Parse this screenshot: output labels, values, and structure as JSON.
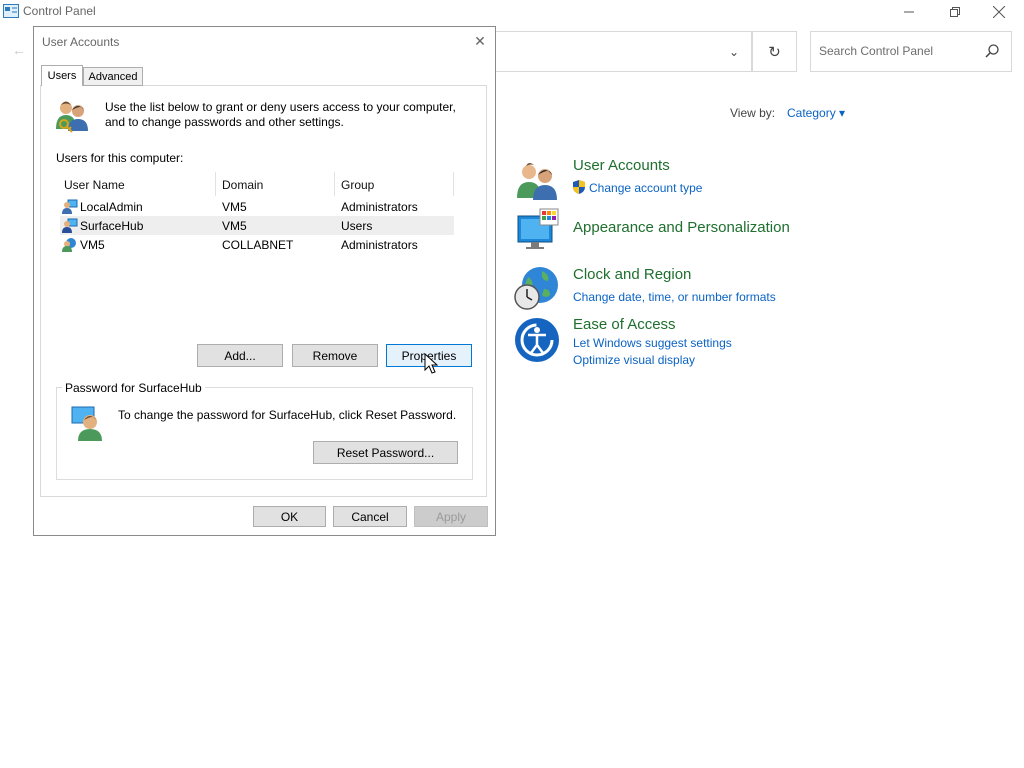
{
  "window": {
    "title": "Control Panel",
    "back_glyph": "←",
    "address_dropdown_glyph": "⌄",
    "refresh_glyph": "↻",
    "search_placeholder": "Search Control Panel"
  },
  "view_by": {
    "label": "View by:",
    "value": "Category ▾"
  },
  "categories": [
    {
      "title": "User Accounts",
      "links": [
        "Change account type"
      ],
      "icon": "users-icon"
    },
    {
      "title": "Appearance and Personalization",
      "links": [],
      "icon": "appearance-icon"
    },
    {
      "title": "Clock and Region",
      "links": [
        "Change date, time, or number formats"
      ],
      "icon": "clock-globe-icon"
    },
    {
      "title": "Ease of Access",
      "links": [
        "Let Windows suggest settings",
        "Optimize visual display"
      ],
      "icon": "ease-of-access-icon"
    }
  ],
  "dialog": {
    "title": "User Accounts",
    "close_glyph": "✕",
    "tabs": [
      "Users",
      "Advanced"
    ],
    "info_text": "Use the list below to grant or deny users access to your computer, and to change passwords and other settings.",
    "users_label": "Users for this computer:",
    "columns": [
      "User Name",
      "Domain",
      "Group"
    ],
    "users": [
      {
        "name": "LocalAdmin",
        "domain": "VM5",
        "group": "Administrators"
      },
      {
        "name": "SurfaceHub",
        "domain": "VM5",
        "group": "Users"
      },
      {
        "name": "VM5",
        "domain": "COLLABNET",
        "group": "Administrators"
      }
    ],
    "selected_user": "SurfaceHub",
    "buttons": {
      "add": "Add...",
      "remove": "Remove",
      "properties": "Properties"
    },
    "password_group": {
      "legend": "Password for SurfaceHub",
      "text": "To change the password for SurfaceHub, click Reset Password.",
      "reset": "Reset Password..."
    },
    "footer": {
      "ok": "OK",
      "cancel": "Cancel",
      "apply": "Apply"
    }
  },
  "colors": {
    "link": "#0b63c4",
    "category_title": "#1f6f2f",
    "focus_border": "#0078d7"
  }
}
